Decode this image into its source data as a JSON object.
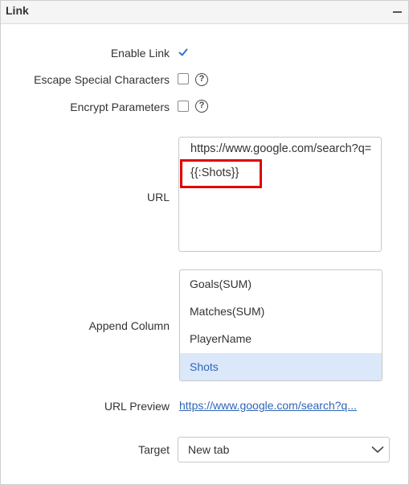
{
  "panel": {
    "title": "Link"
  },
  "enable_link": {
    "label": "Enable Link",
    "checked": true
  },
  "escape_special": {
    "label": "Escape Special Characters",
    "checked": false,
    "help": "?"
  },
  "encrypt_params": {
    "label": "Encrypt Parameters",
    "checked": false,
    "help": "?"
  },
  "url": {
    "label": "URL",
    "text": "https://www.google.com/search?q=",
    "token": "{{:Shots}}"
  },
  "append_column": {
    "label": "Append Column",
    "items": [
      "Goals(SUM)",
      "Matches(SUM)",
      "PlayerName",
      "Shots"
    ],
    "selected": "Shots"
  },
  "url_preview": {
    "label": "URL Preview",
    "value": "https://www.google.com/search?q..."
  },
  "target": {
    "label": "Target",
    "value": "New tab"
  },
  "colors": {
    "accent": "#2f66b6",
    "checkbox_fill": "#2f74c8",
    "selected_bg": "#dbe8f9",
    "highlight_border": "#e00000"
  },
  "icons": {
    "collapse": "minus-icon",
    "checkbox": "checkmark-icon",
    "help": "question-circle-icon",
    "dropdown": "chevron-down-icon"
  }
}
